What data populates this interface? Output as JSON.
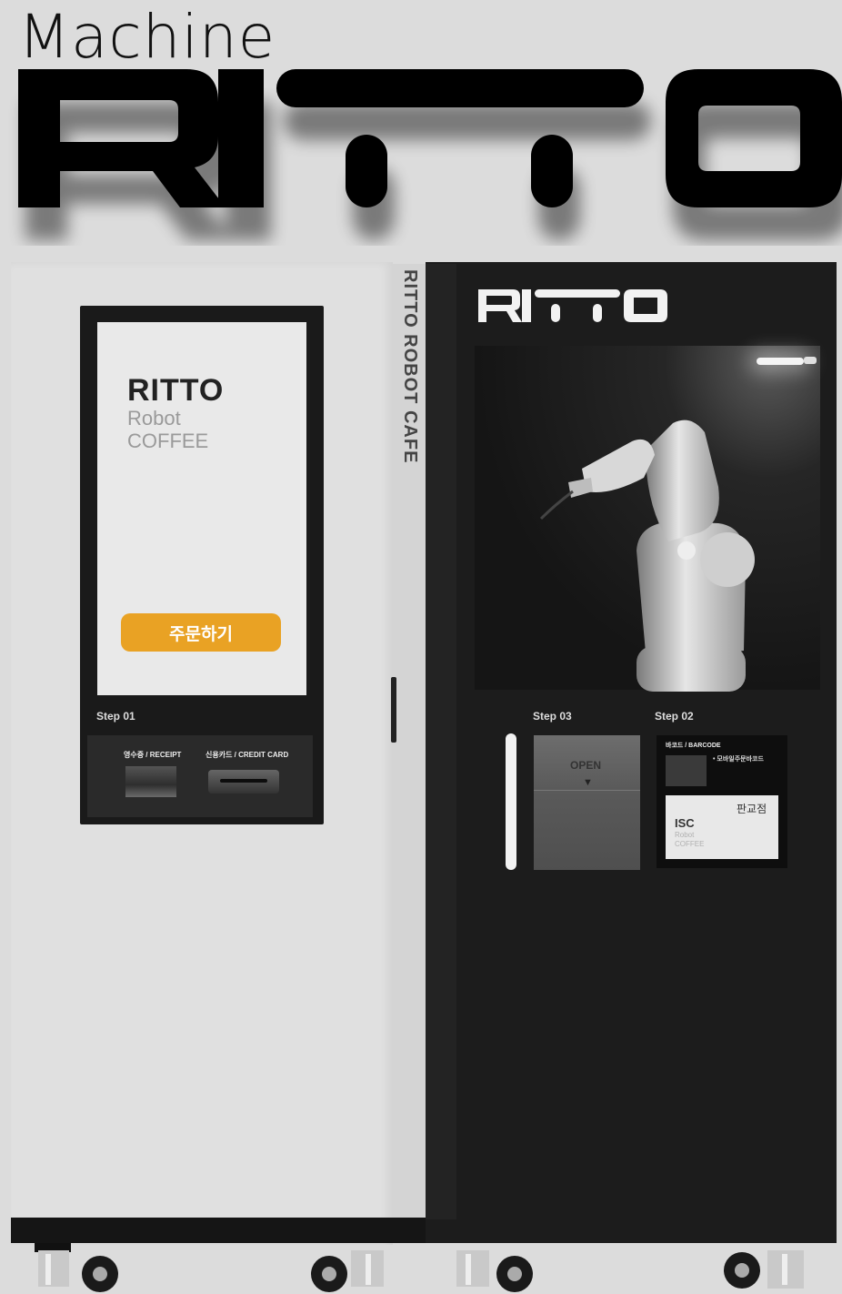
{
  "headline": "Machine",
  "logo_text": "RITTO",
  "kiosk": {
    "screen": {
      "brand": "RITTO",
      "line1": "Robot",
      "line2": "COFFEE",
      "order_button": "주문하기"
    },
    "step_label": "Step 01",
    "receipt_label": "영수증 / RECEIPT",
    "card_label": "신용카드 / CREDIT CARD"
  },
  "side_strip_text": "RITTO ROBOT CAFE",
  "booth": {
    "logo_text": "RITTO",
    "pickup": {
      "step_label": "Step 03",
      "door_label": "OPEN",
      "arrow": "▼"
    },
    "barcode": {
      "step_label": "Step 02",
      "label": "바코드 / BARCODE",
      "note": "• 모바일주문바코드",
      "store_name": "판교점",
      "card_title": "ISC",
      "card_line1": "Robot",
      "card_line2": "COFFEE"
    }
  },
  "colors": {
    "accent": "#e9a224",
    "booth": "#1c1c1c",
    "kiosk": "#e0e0e0",
    "background": "#dcdcdc"
  }
}
